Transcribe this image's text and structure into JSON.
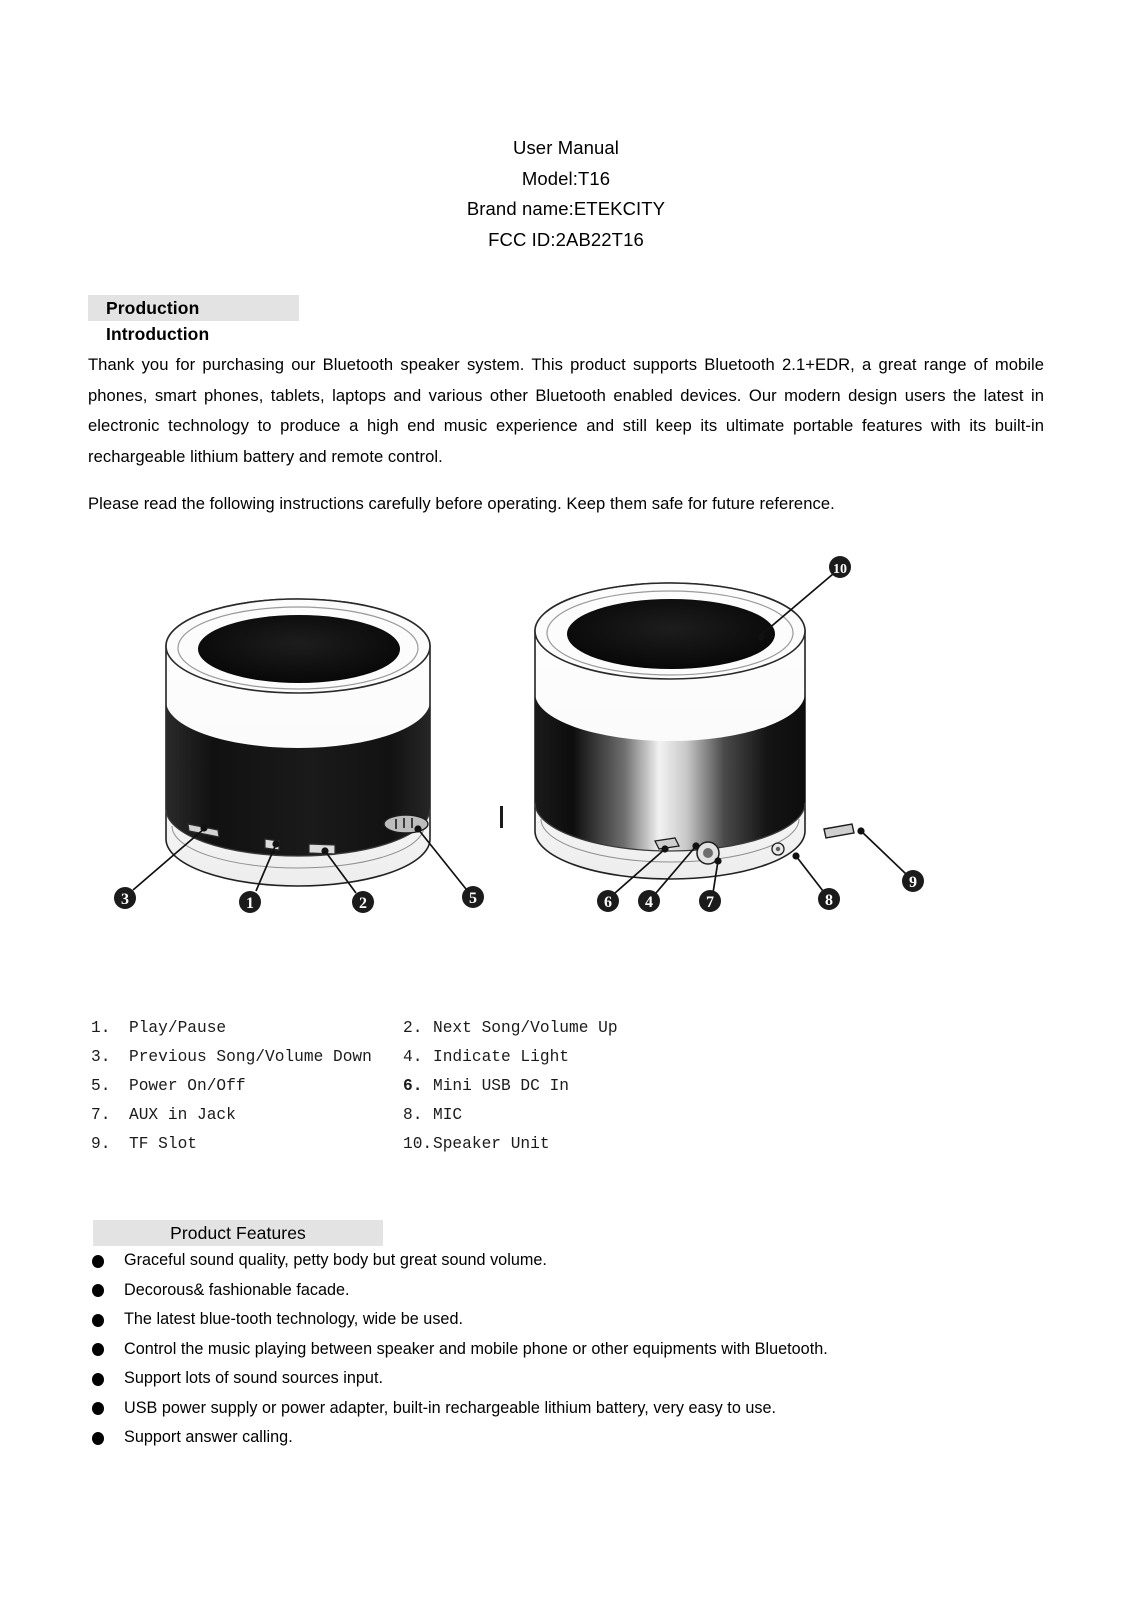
{
  "document": {
    "title_lines": [
      "User Manual",
      "Model:T16",
      "Brand name:ETEKCITY",
      "FCC ID:2AB22T16"
    ],
    "title": "User Manual",
    "model": "Model:T16",
    "brand": "Brand name:ETEKCITY",
    "fcc_id": "FCC ID:2AB22T16"
  },
  "sections": {
    "introduction": {
      "heading": "Production Introduction",
      "paragraph": "Thank you for purchasing our Bluetooth speaker system. This product supports Bluetooth 2.1+EDR, a great range of mobile phones, smart phones, tablets, laptops and various other Bluetooth enabled devices. Our modern design users the latest in electronic technology to produce a high end music experience and still keep its ultimate portable features with its built-in rechargeable lithium battery and remote control.",
      "note": "Please read the following instructions carefully before operating. Keep them safe for future reference."
    },
    "features": {
      "heading": "Product Features",
      "items": [
        "Graceful sound quality, petty body but great sound volume.",
        "Decorous& fashionable facade.",
        "The latest blue-tooth technology, wide be used.",
        "Control the music playing between speaker and mobile phone or other equipments with Bluetooth.",
        "Support lots of sound sources input.",
        "USB power supply or power adapter, built-in rechargeable lithium battery, very easy to use.",
        "Support answer calling."
      ]
    }
  },
  "figure": {
    "alt": "Two views of the Bluetooth speaker with numbered callouts",
    "callouts": [
      {
        "id": "3",
        "view": "left"
      },
      {
        "id": "1",
        "view": "left"
      },
      {
        "id": "2",
        "view": "left"
      },
      {
        "id": "5",
        "view": "left"
      },
      {
        "id": "6",
        "view": "right"
      },
      {
        "id": "4",
        "view": "right"
      },
      {
        "id": "7",
        "view": "right"
      },
      {
        "id": "8",
        "view": "right"
      },
      {
        "id": "9",
        "view": "right"
      },
      {
        "id": "10",
        "view": "right"
      }
    ],
    "labels": {
      "c1": "1",
      "c2": "2",
      "c3": "3",
      "c4": "4",
      "c5": "5",
      "c6": "6",
      "c7": "7",
      "c8": "8",
      "c9": "9",
      "c10": "10"
    }
  },
  "parts_list": {
    "rows": [
      {
        "left": {
          "num": "1.",
          "label": "Play/Pause",
          "bold_num": false
        },
        "right": {
          "num": "2.",
          "label": "Next Song/Volume Up",
          "bold_num": false
        }
      },
      {
        "left": {
          "num": "3.",
          "label": "Previous Song/Volume Down",
          "bold_num": false
        },
        "right": {
          "num": "4.",
          "label": "Indicate Light",
          "bold_num": false
        }
      },
      {
        "left": {
          "num": "5.",
          "label": "Power On/Off",
          "bold_num": false
        },
        "right": {
          "num": "6.",
          "label": "Mini USB DC In",
          "bold_num": true
        }
      },
      {
        "left": {
          "num": "7.",
          "label": "AUX in Jack",
          "bold_num": false
        },
        "right": {
          "num": "8.",
          "label": "MIC",
          "bold_num": false
        }
      },
      {
        "left": {
          "num": "9.",
          "label": "TF Slot",
          "bold_num": false
        },
        "right": {
          "num": "10.",
          "label": "Speaker Unit",
          "bold_num": false
        }
      }
    ]
  },
  "colors": {
    "heading_bar": "#e3e3e3",
    "text": "#000000",
    "speaker_body_dark": "#101010",
    "speaker_shell_white": "#fdfdfd"
  }
}
